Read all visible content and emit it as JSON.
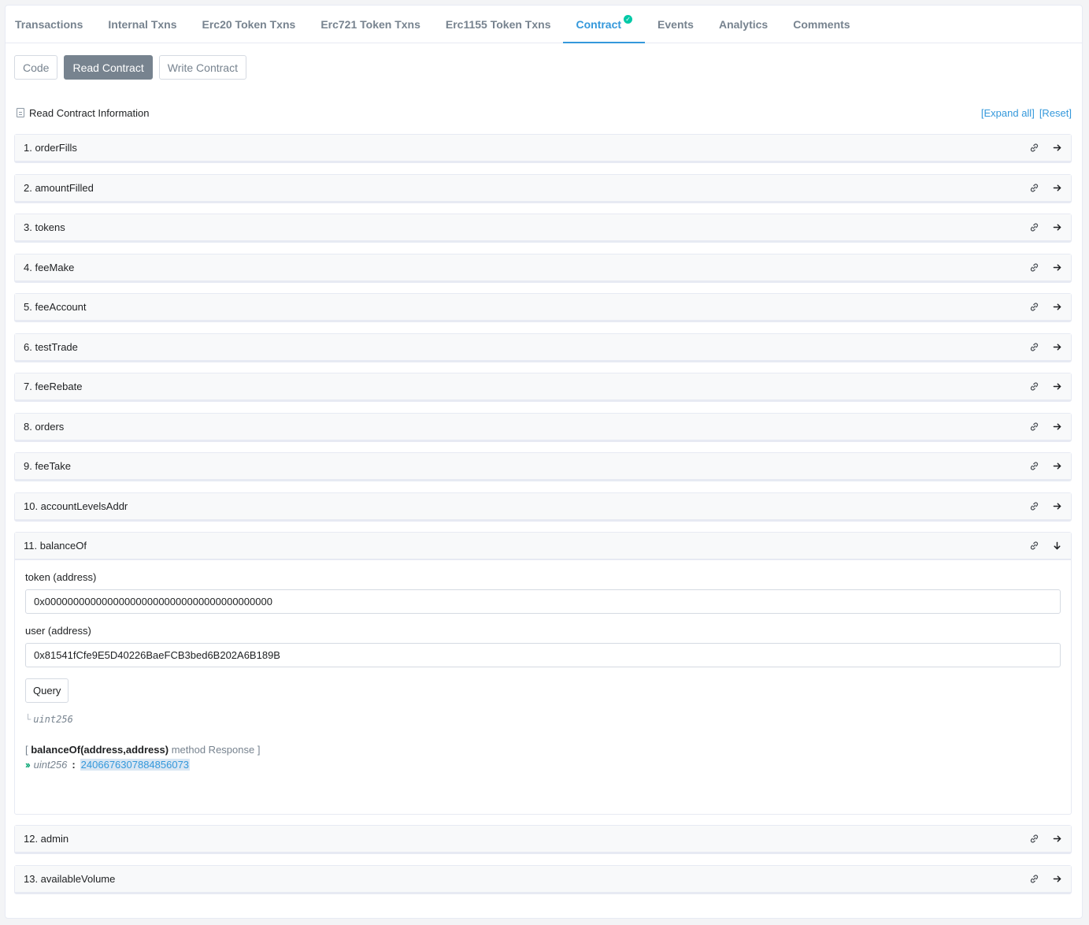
{
  "tabs": [
    {
      "label": "Transactions"
    },
    {
      "label": "Internal Txns"
    },
    {
      "label": "Erc20 Token Txns"
    },
    {
      "label": "Erc721 Token Txns"
    },
    {
      "label": "Erc1155 Token Txns"
    },
    {
      "label": "Contract"
    },
    {
      "label": "Events"
    },
    {
      "label": "Analytics"
    },
    {
      "label": "Comments"
    }
  ],
  "subtabs": {
    "code": "Code",
    "read": "Read Contract",
    "write": "Write Contract"
  },
  "info": {
    "title": "Read Contract Information",
    "expand_all": "[Expand all]",
    "reset": "[Reset]"
  },
  "methods": [
    {
      "label": "1. orderFills"
    },
    {
      "label": "2. amountFilled"
    },
    {
      "label": "3. tokens"
    },
    {
      "label": "4. feeMake"
    },
    {
      "label": "5. feeAccount"
    },
    {
      "label": "6. testTrade"
    },
    {
      "label": "7. feeRebate"
    },
    {
      "label": "8. orders"
    },
    {
      "label": "9. feeTake"
    },
    {
      "label": "10. accountLevelsAddr"
    },
    {
      "label": "11. balanceOf"
    },
    {
      "label": "12. admin"
    },
    {
      "label": "13. availableVolume"
    }
  ],
  "balanceOf": {
    "token_label": "token (address)",
    "token_value": "0x0000000000000000000000000000000000000000",
    "user_label": "user (address)",
    "user_value": "0x81541fCfe9E5D40226BaeFCB3bed6B202A6B189B",
    "query_label": "Query",
    "output_type": "uint256",
    "resp_open": "[ ",
    "resp_method": "balanceOf(address,address)",
    "resp_close": " method Response ]",
    "resp_type": "uint256",
    "resp_sep": ":",
    "resp_value": "2406676307884856073"
  },
  "colors": {
    "accent": "#3498db",
    "verified": "#00c9a7",
    "chevron": "#00a36f"
  }
}
